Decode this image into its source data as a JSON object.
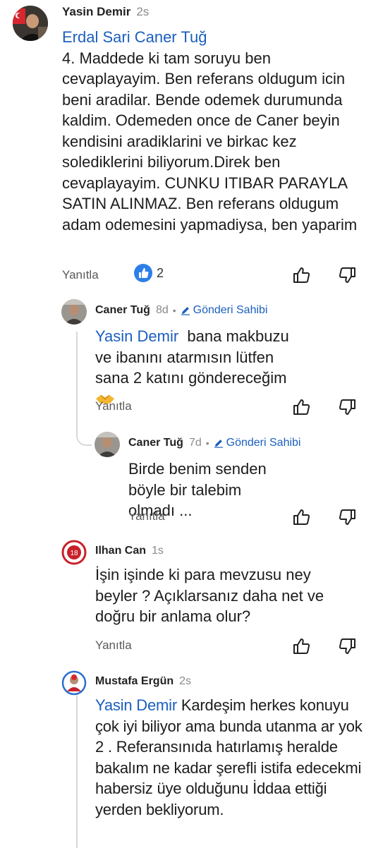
{
  "comments": [
    {
      "author": "Yasin Demir",
      "time": "2s",
      "mention": "Erdal Sari Caner Tuğ",
      "text": "4. Maddede ki tam soruyu ben cevaplayayim. Ben referans oldugum icin beni aradilar. Bende odemek durumunda kaldim. Odemeden once de Caner beyin kendisini aradiklarini ve birkac kez solediklerini biliyorum.Direk ben cevaplayayim. CUNKU ITIBAR PARAYLA SATIN ALINMAZ. Ben referans oldugum adam odemesini yapmadiysa, ben yaparim",
      "reply_label": "Yanıtla",
      "reaction_count": "2"
    },
    {
      "author": "Caner Tuğ",
      "time": "8d",
      "badge": "Gönderi Sahibi",
      "mention": "Yasin Demir",
      "text": "bana makbuzu ve ibanını atarmısın lütfen sana 2 katını göndereceğim",
      "reply_label": "Yanıtla"
    },
    {
      "author": "Caner Tuğ",
      "time": "7d",
      "badge": "Gönderi Sahibi",
      "text": "Birde benim senden böyle bir talebim olmadı ...",
      "reply_label": "Yanıtla"
    },
    {
      "author": "Ilhan Can",
      "time": "1s",
      "text": "İşin işinde ki para mevzusu ney beyler ? Açıklarsanız daha net ve doğru bir anlama olur?",
      "reply_label": "Yanıtla"
    },
    {
      "author": "Mustafa Ergün",
      "time": "2s",
      "mention": "Yasin Demir",
      "text": "Kardeşim herkes konuyu çok iyi biliyor ama bunda utanma ar yok 2 . Referansınıda hatırlamış heralde bakalım ne kadar şerefli istifa edecekmi  habersiz üye olduğunu İddaa ettiği yerden bekliyorum."
    }
  ],
  "colors": {
    "accent": "#1b5fbf",
    "reaction": "#2d7ee8",
    "muted": "#8a8a8a"
  },
  "icons": [
    "like-icon",
    "dislike-icon",
    "pencil-icon",
    "reaction-like-icon"
  ]
}
